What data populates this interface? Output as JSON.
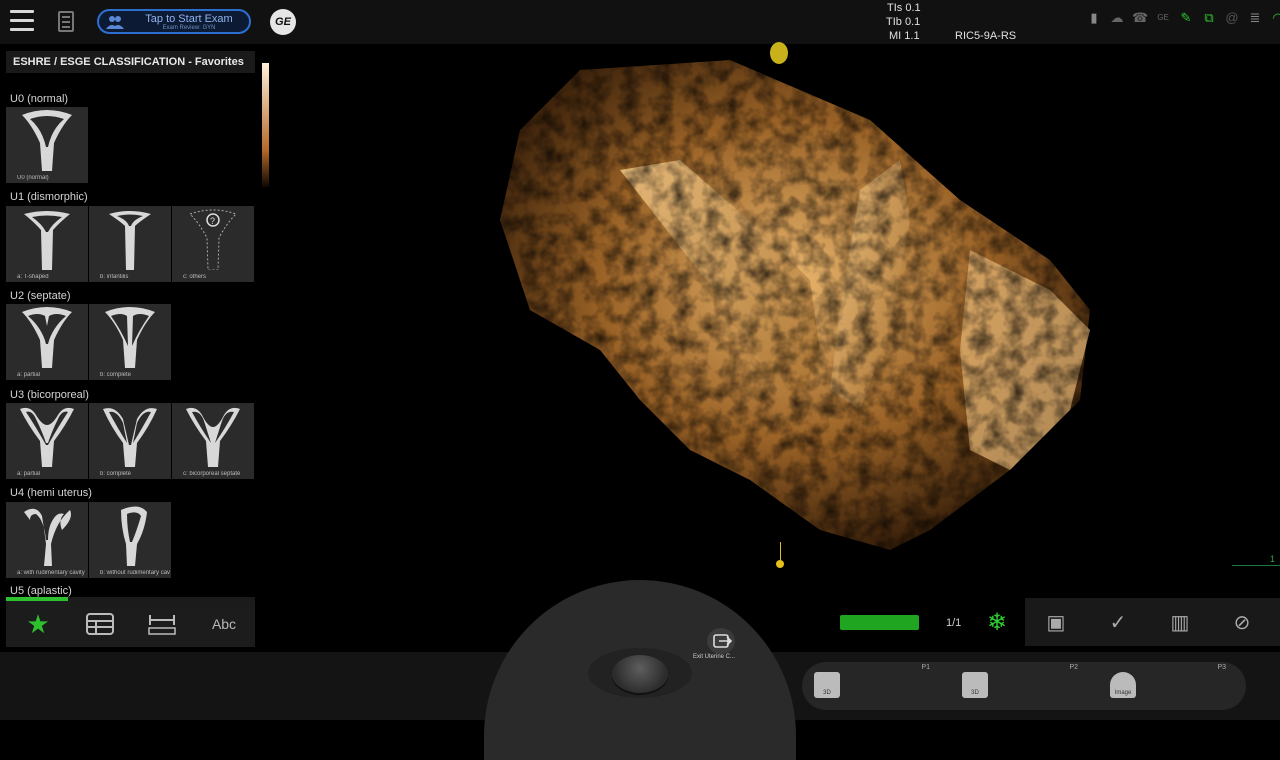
{
  "topbar": {
    "start_exam_label": "Tap to Start Exam",
    "exam_review_label": "Exam Review: GYN",
    "ge_logo_text": "GE",
    "tis": "TIs  0.1",
    "tib": "TIb  0.1",
    "mi": "MI   1.1",
    "probe": "RIC5-9A-RS"
  },
  "panel": {
    "header": "ESHRE / ESGE CLASSIFICATION - Favorites",
    "groups": [
      {
        "title": "U0 (normal)",
        "items": [
          "U0 (normal)"
        ]
      },
      {
        "title": "U1 (dismorphic)",
        "items": [
          "a: T-shaped",
          "b: infantilis",
          "c: others"
        ]
      },
      {
        "title": "U2 (septate)",
        "items": [
          "a: partial",
          "b: complete"
        ]
      },
      {
        "title": "U3 (bicorporeal)",
        "items": [
          "a: partial",
          "b: complete",
          "c: bicorporeal septate"
        ]
      },
      {
        "title": "U4 (hemi uterus)",
        "items": [
          "a: with rudimentary cavity",
          "b: without rudimentary cavity"
        ]
      },
      {
        "title": "U5 (aplastic)",
        "items": []
      }
    ],
    "tab_text": "Abc"
  },
  "bottom": {
    "exit_label": "Exit Uterine C...",
    "frame_count": "1/1",
    "p1": "P1",
    "p2": "P2",
    "p3": "P3",
    "p1_icon_text": "3D",
    "p2_icon_text": "3D",
    "p3_icon_text": "Image"
  },
  "corner_number": "1",
  "colors": {
    "accent_green": "#2ec02e",
    "exam_blue": "#2d6fd1",
    "volume_sepia": "#c88a3c"
  }
}
